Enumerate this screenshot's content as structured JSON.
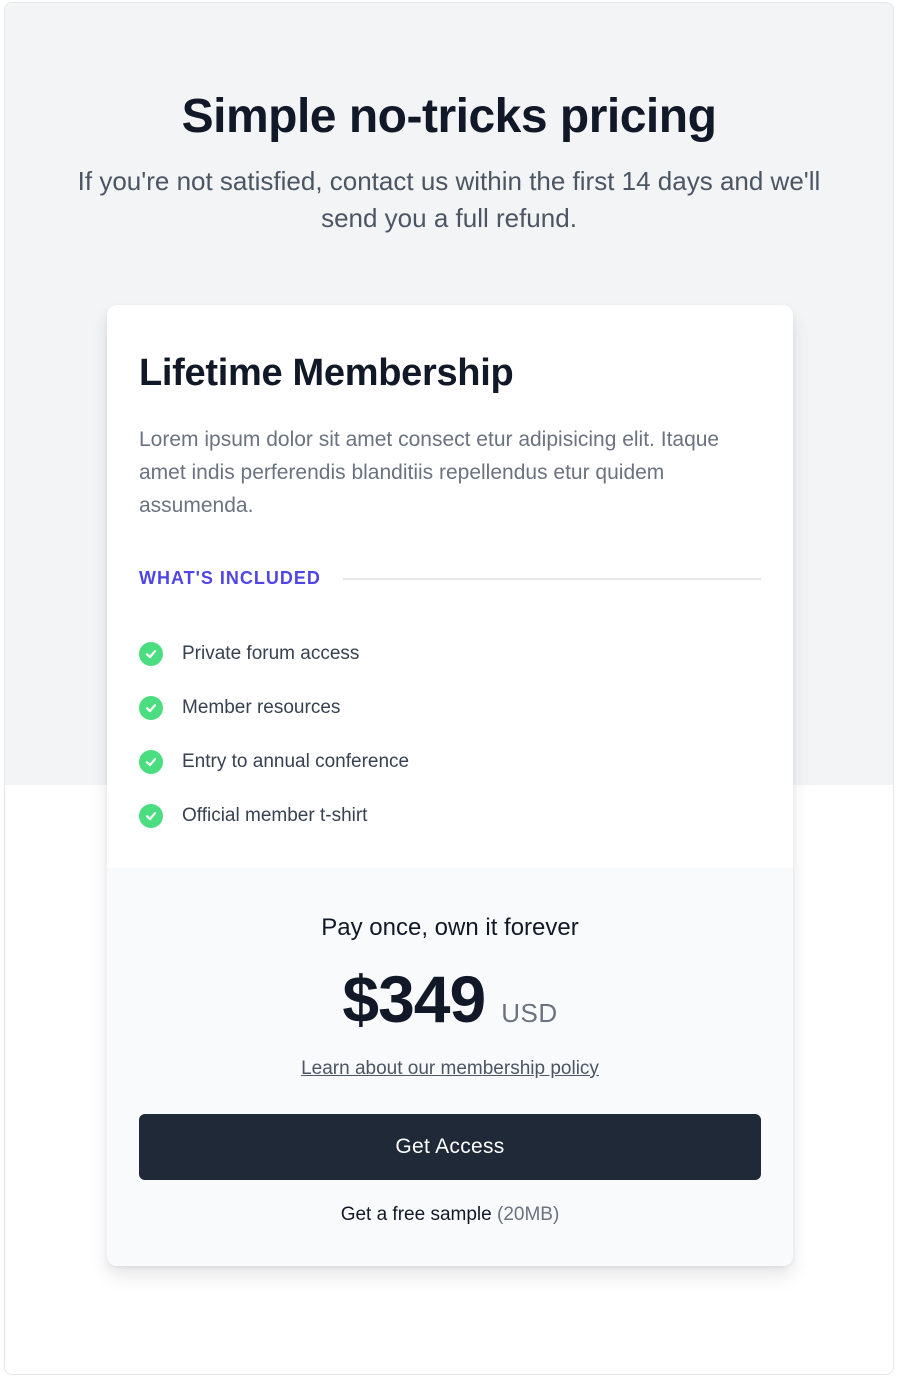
{
  "header": {
    "title": "Simple no-tricks pricing",
    "subtitle": "If you're not satisfied, contact us within the first 14 days and we'll send you a full refund."
  },
  "plan": {
    "title": "Lifetime Membership",
    "description": "Lorem ipsum dolor sit amet consect etur adipisicing elit. Itaque amet indis perferendis blanditiis repellendus etur quidem assumenda.",
    "included_label": "WHAT'S INCLUDED",
    "features": [
      {
        "label": "Private forum access",
        "icon": "check-circle-icon"
      },
      {
        "label": "Member resources",
        "icon": "check-circle-icon"
      },
      {
        "label": "Entry to annual conference",
        "icon": "check-circle-icon"
      },
      {
        "label": "Official member t-shirt",
        "icon": "check-circle-icon"
      }
    ]
  },
  "purchase": {
    "tagline": "Pay once, own it forever",
    "price": "$349",
    "currency": "USD",
    "policy_link": "Learn about our membership policy",
    "cta_label": "Get Access",
    "sample_label": "Get a free sample",
    "sample_size": "(20MB)"
  },
  "colors": {
    "accent": "#4f46e5",
    "check": "#4ade80",
    "button_bg": "#1f2937",
    "band_bg": "#f3f4f6"
  }
}
